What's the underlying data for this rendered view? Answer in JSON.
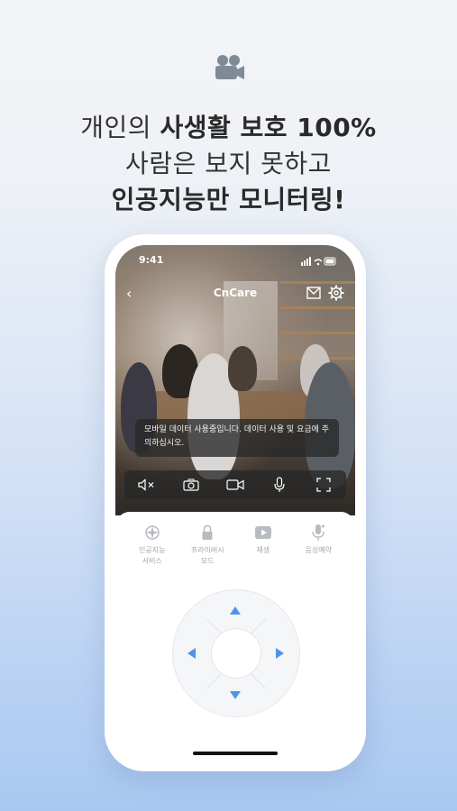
{
  "header": {
    "icon": "camera-icon",
    "line1_regular": "개인의 ",
    "line1_bold": "사생활 보호 100%",
    "line2": "사람은 보지 못하고",
    "line3": "인공지능만 모니터링!"
  },
  "status_bar": {
    "time": "9:41"
  },
  "nav": {
    "title": "CnCare"
  },
  "toast": {
    "text": "모바일 데이터 사용중입니다. 데이터 사용 및 요금에 주의하십시오."
  },
  "modes": [
    {
      "icon": "ai-chip-icon",
      "line1": "인공지능",
      "line2": "서비스"
    },
    {
      "icon": "lock-icon",
      "line1": "프라이버시",
      "line2": "모드"
    },
    {
      "icon": "play-icon",
      "line1": "재생",
      "line2": ""
    },
    {
      "icon": "mic-icon",
      "line1": "음성예약",
      "line2": ""
    }
  ],
  "colors": {
    "accent": "#4f95e8",
    "text": "#333333"
  }
}
